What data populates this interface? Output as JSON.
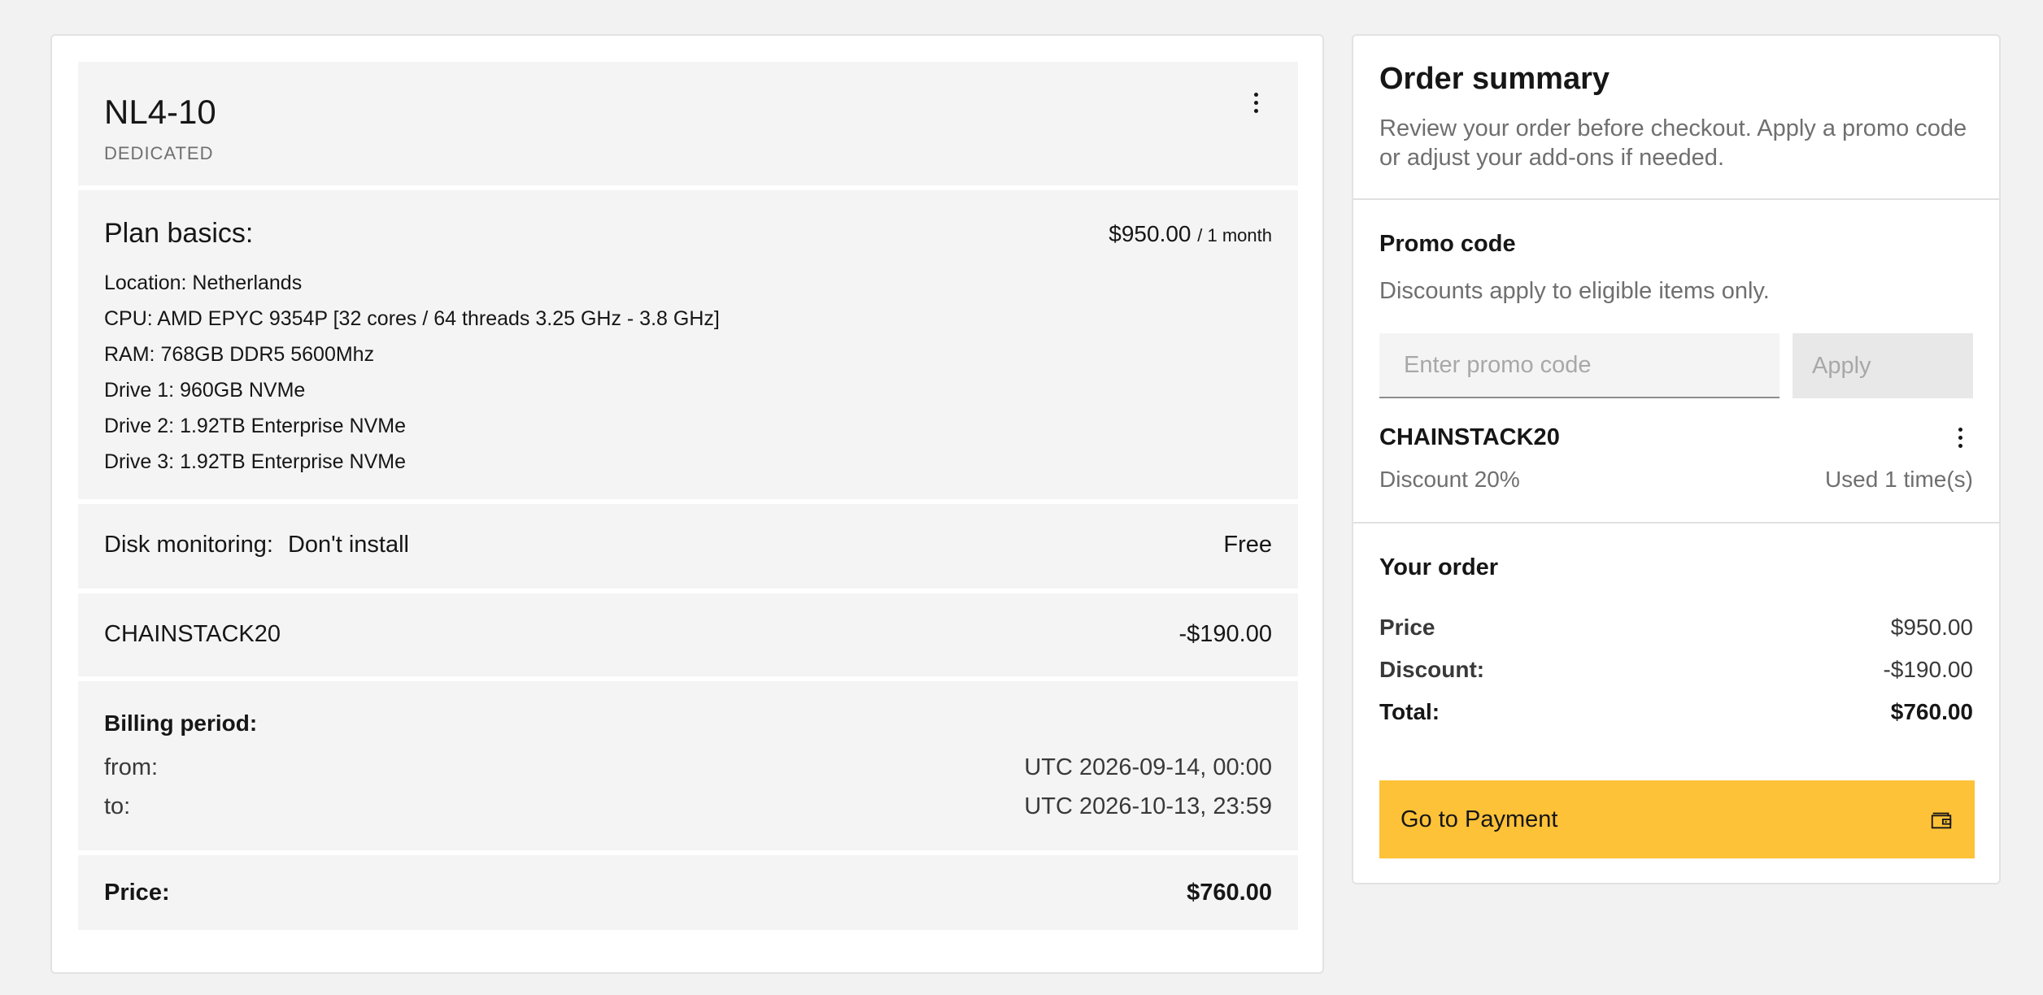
{
  "server": {
    "name": "NL4-10",
    "type": "DEDICATED"
  },
  "plan": {
    "title": "Plan basics:",
    "price": "$950.00",
    "period": "/ 1 month",
    "specs": [
      "Location: Netherlands",
      "CPU: AMD EPYC 9354P [32 cores / 64 threads 3.25 GHz - 3.8 GHz]",
      "RAM: 768GB DDR5 5600Mhz",
      "Drive 1: 960GB NVMe",
      "Drive 2: 1.92TB Enterprise NVMe",
      "Drive 3: 1.92TB Enterprise NVMe"
    ]
  },
  "disk_monitoring": {
    "label": "Disk monitoring:",
    "value": "Don't install",
    "price": "Free"
  },
  "promo_line": {
    "code": "CHAINSTACK20",
    "amount": "-$190.00"
  },
  "billing": {
    "title": "Billing period:",
    "from_label": "from:",
    "from_value": "UTC 2026-09-14, 00:00",
    "to_label": "to:",
    "to_value": "UTC 2026-10-13, 23:59"
  },
  "price_row": {
    "label": "Price:",
    "value": "$760.00"
  },
  "summary": {
    "title": "Order summary",
    "description": "Review your order before checkout. Apply a promo code or adjust your add-ons if needed.",
    "promo": {
      "title": "Promo code",
      "description": "Discounts apply to eligible items only.",
      "input_value": "",
      "input_placeholder": "Enter promo code",
      "apply_label": "Apply",
      "applied_code": "CHAINSTACK20",
      "discount_text": "Discount 20%",
      "usage_text": "Used 1 time(s)"
    },
    "order": {
      "title": "Your order",
      "price_label": "Price",
      "price_value": "$950.00",
      "discount_label": "Discount:",
      "discount_value": "-$190.00",
      "total_label": "Total:",
      "total_value": "$760.00"
    },
    "pay_button_label": "Go to Payment",
    "pay_button_icon": "wallet-icon",
    "accent_color": "#fdc238"
  }
}
